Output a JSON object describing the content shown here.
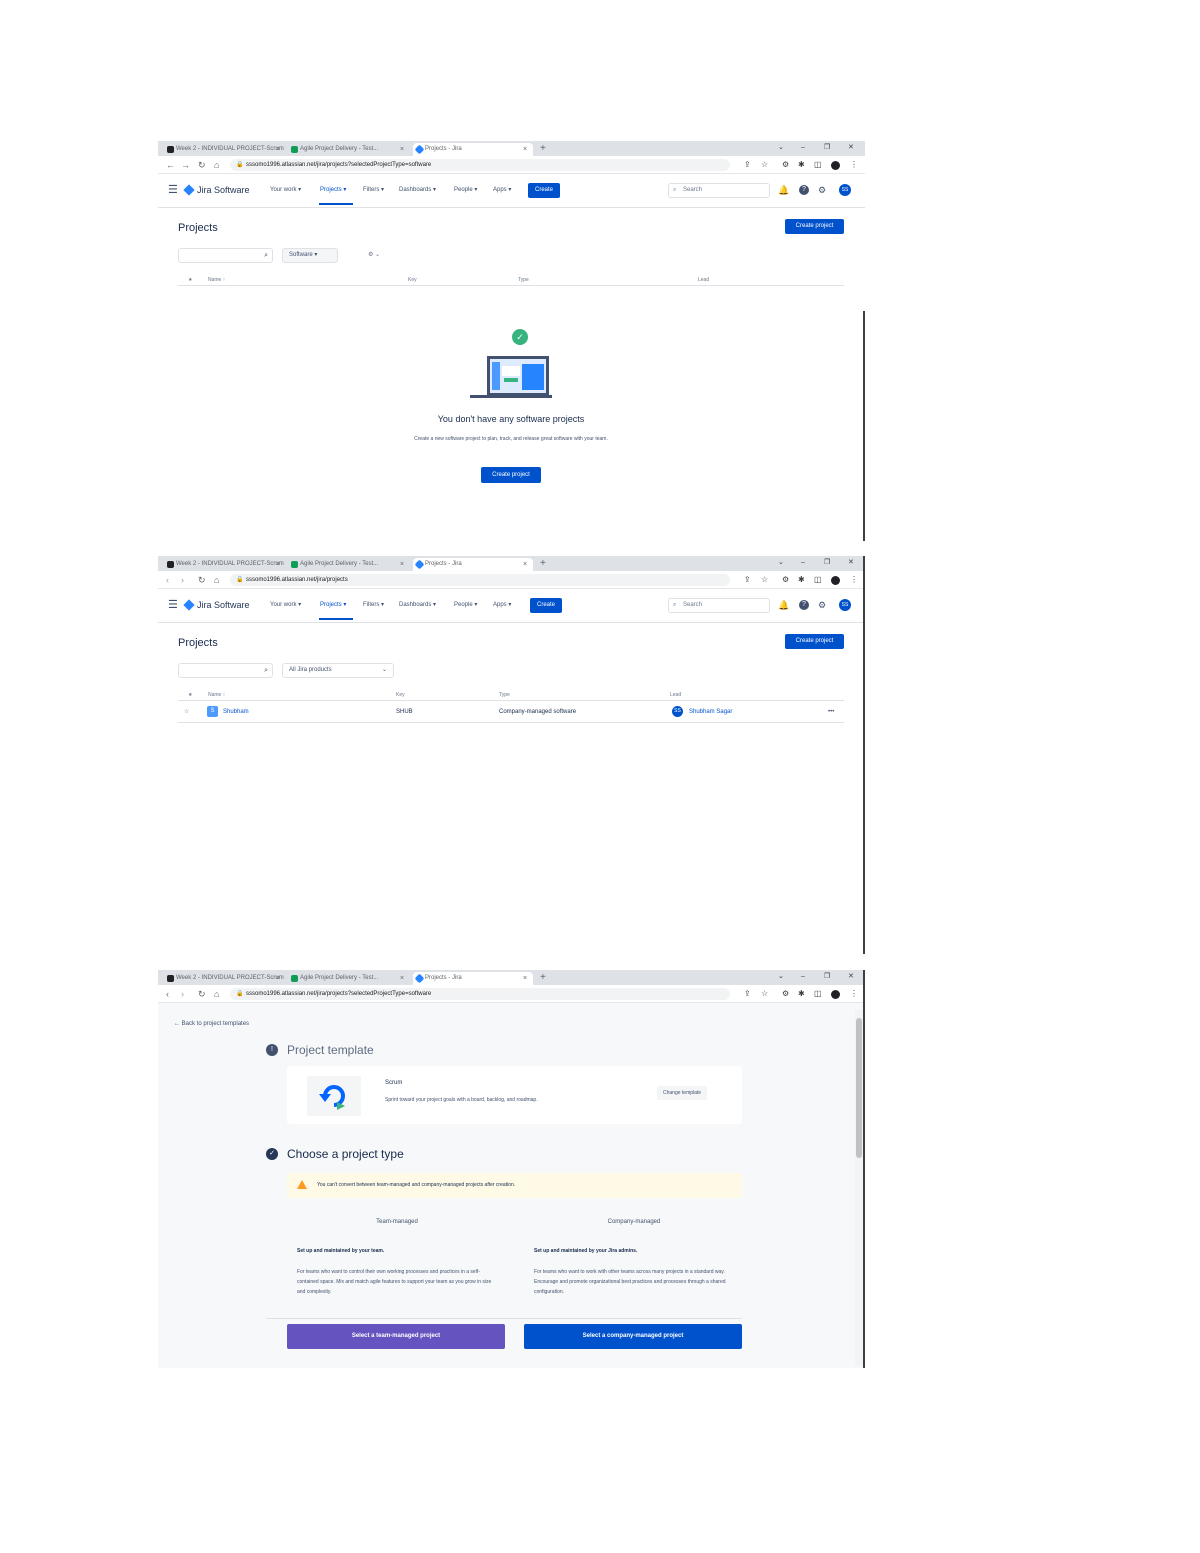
{
  "browser": {
    "tabs": [
      {
        "title": "Week 2 - INDIVIDUAL PROJECT-Scrum"
      },
      {
        "title": "Agile Project Delivery - Test..."
      },
      {
        "title": "Projects - Jira"
      }
    ],
    "new_tab": "+",
    "close": "×",
    "win_controls": [
      "⌄",
      "–",
      "❐",
      "✕"
    ],
    "url_create": "sssomo1996.atlassian.net/jira/projects?selectedProjectType=software",
    "url_list": "sssomo1996.atlassian.net/jira/projects",
    "nav": {
      "back": "←",
      "forward": "→",
      "reload": "↻",
      "home": "⌂"
    },
    "extensions": [
      "⇪",
      "☆",
      "⚙",
      "✱",
      "◫"
    ]
  },
  "jira": {
    "product": "Jira Software",
    "nav": [
      "Your work ▾",
      "Projects ▾",
      "Filters ▾",
      "Dashboards ▾",
      "People ▾",
      "Apps ▾"
    ],
    "create_label": "Create",
    "search_placeholder": "Search",
    "header_icons": [
      "bell-icon",
      "help-icon",
      "settings-icon"
    ],
    "header_glyphs": [
      "🔔",
      "?",
      "⚙"
    ],
    "avatar": "SS",
    "page_title": "Projects",
    "create_project": "Create project",
    "search_icon": "⌕",
    "filter_software": "Software ▾",
    "filter_all": "All Jira products",
    "filter_chevron": "⌄",
    "filter_extra": "⚙ ⌄",
    "columns": {
      "star": "★",
      "name": "Name ↑",
      "key": "Key",
      "type": "Type",
      "lead": "Lead"
    }
  },
  "empty_state": {
    "title": "You don't have any software projects",
    "description": "Create a new software project to plan, track, and release great software with your team.",
    "button": "Create project",
    "check": "✓"
  },
  "project_row": {
    "star": "☆",
    "icon": "S",
    "name": "Shubham",
    "key": "SHUB",
    "type": "Company-managed software",
    "lead_avatar": "SS",
    "lead": "Shubham Sagar",
    "more": "•••"
  },
  "create_flow": {
    "back_link": "← Back to project templates",
    "step1_icon": "!",
    "step1_title": "Project template",
    "template_name": "Scrum",
    "template_desc": "Sprint toward your project goals with a board, backlog, and roadmap.",
    "change_template": "Change template",
    "step2_icon": "✓",
    "step2_title": "Choose a project type",
    "warning": "You can't convert between team-managed and company-managed projects after creation.",
    "team": {
      "title": "Team-managed",
      "subtitle": "Set up and maintained by your team.",
      "description": "For teams who want to control their own working processes and practices in a self-contained space. Mix and match agile features to support your team as you grow in size and complexity.",
      "button": "Select a team-managed project"
    },
    "company": {
      "title": "Company-managed",
      "subtitle": "Set up and maintained by your Jira admins.",
      "description": "For teams who want to work with other teams across many projects in a standard way. Encourage and promote organizational best practices and processes through a shared configuration.",
      "button": "Select a company-managed project"
    }
  },
  "colors": {
    "brand": "#0052cc",
    "team_button": "#6554c0",
    "success": "#36b37e",
    "warning": "#ff991f"
  }
}
